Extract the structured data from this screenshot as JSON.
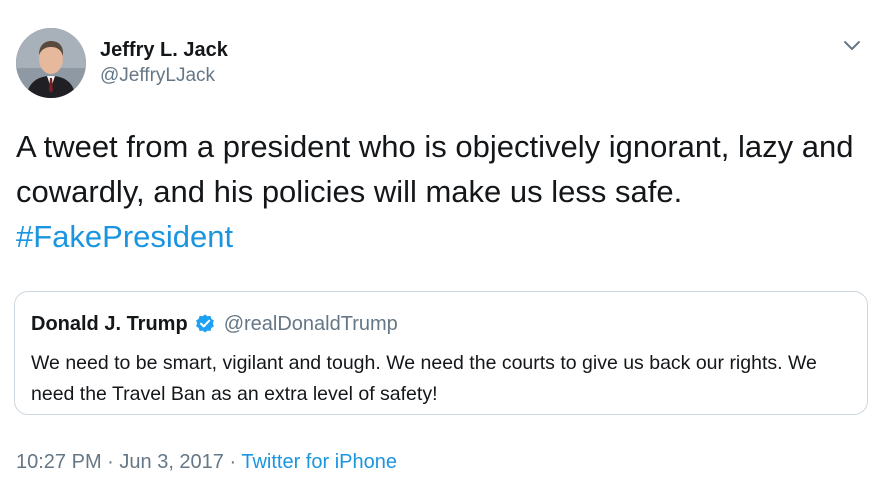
{
  "author": {
    "display_name": "Jeffry L. Jack",
    "handle": "@JeffryLJack",
    "avatar_icon": "person-portrait-avatar"
  },
  "menu": {
    "icon": "chevron-down-icon"
  },
  "tweet": {
    "text": "A tweet from a president who is objectively ignorant, lazy and cowardly, and his policies will make us less safe.",
    "hashtag": "#FakePresident"
  },
  "quoted_tweet": {
    "display_name": "Donald J. Trump",
    "verified_icon": "verified-badge-icon",
    "handle": "@realDonaldTrump",
    "text": "We need to be smart, vigilant and tough. We need the courts to give us back our rights. We need the Travel Ban as an extra level of safety!"
  },
  "footer": {
    "time": "10:27 PM",
    "separator1": " · ",
    "date": "Jun 3, 2017",
    "separator2": " · ",
    "source": "Twitter for iPhone"
  },
  "colors": {
    "link": "#1b95e0",
    "secondary_text": "#657786",
    "border": "#ccd6dd",
    "verified": "#1da1f2"
  }
}
